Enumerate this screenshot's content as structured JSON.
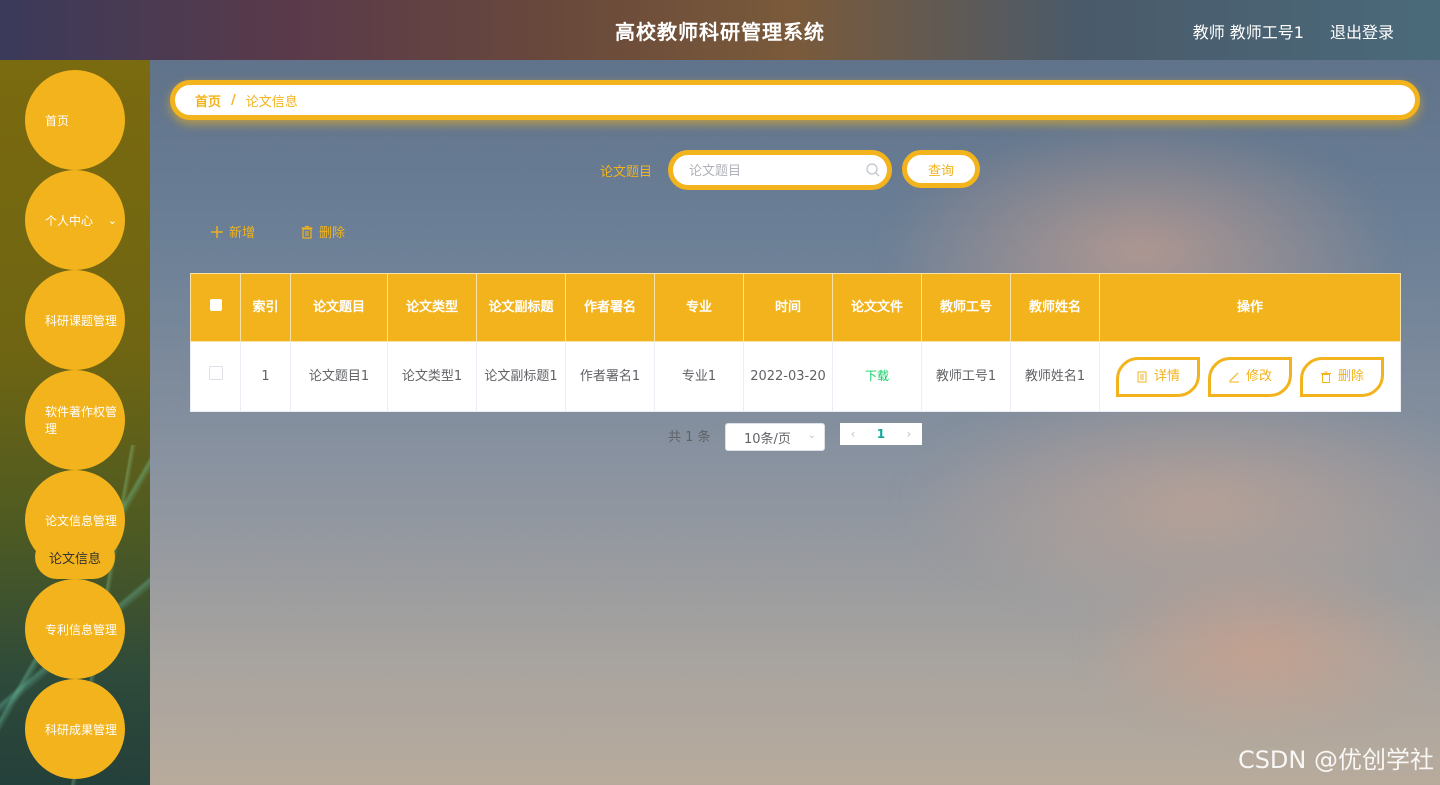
{
  "header": {
    "title": "高校教师科研管理系统",
    "user": "教师 教师工号1",
    "logout": "退出登录"
  },
  "sidebar": {
    "items": [
      {
        "label": "首页"
      },
      {
        "label": "个人中心",
        "has_submenu": true
      },
      {
        "label": "科研课题管理"
      },
      {
        "label": "软件著作权管理"
      },
      {
        "label": "论文信息管理",
        "sub_item": "论文信息"
      },
      {
        "label": "专利信息管理"
      },
      {
        "label": "科研成果管理"
      }
    ]
  },
  "breadcrumb": {
    "home": "首页",
    "separator": "/",
    "current": "论文信息"
  },
  "search": {
    "label": "论文题目",
    "placeholder": "论文题目",
    "value": "",
    "button": "查询"
  },
  "actions": {
    "add": "新增",
    "delete": "删除"
  },
  "table": {
    "columns": [
      "索引",
      "论文题目",
      "论文类型",
      "论文副标题",
      "作者署名",
      "专业",
      "时间",
      "论文文件",
      "教师工号",
      "教师姓名",
      "操作"
    ],
    "rows": [
      {
        "index": "1",
        "title": "论文题目1",
        "type": "论文类型1",
        "subtitle": "论文副标题1",
        "author": "作者署名1",
        "major": "专业1",
        "time": "2022-03-20",
        "file": "下载",
        "teacher_id": "教师工号1",
        "teacher_name": "教师姓名1",
        "ops": {
          "detail": "详情",
          "edit": "修改",
          "delete": "删除"
        }
      }
    ]
  },
  "pagination": {
    "total": "共 1 条",
    "page_size": "10条/页",
    "current_page": "1"
  },
  "watermark": "CSDN @优创学社",
  "colors": {
    "accent": "#f2b31c",
    "link_green": "#13ce66"
  }
}
